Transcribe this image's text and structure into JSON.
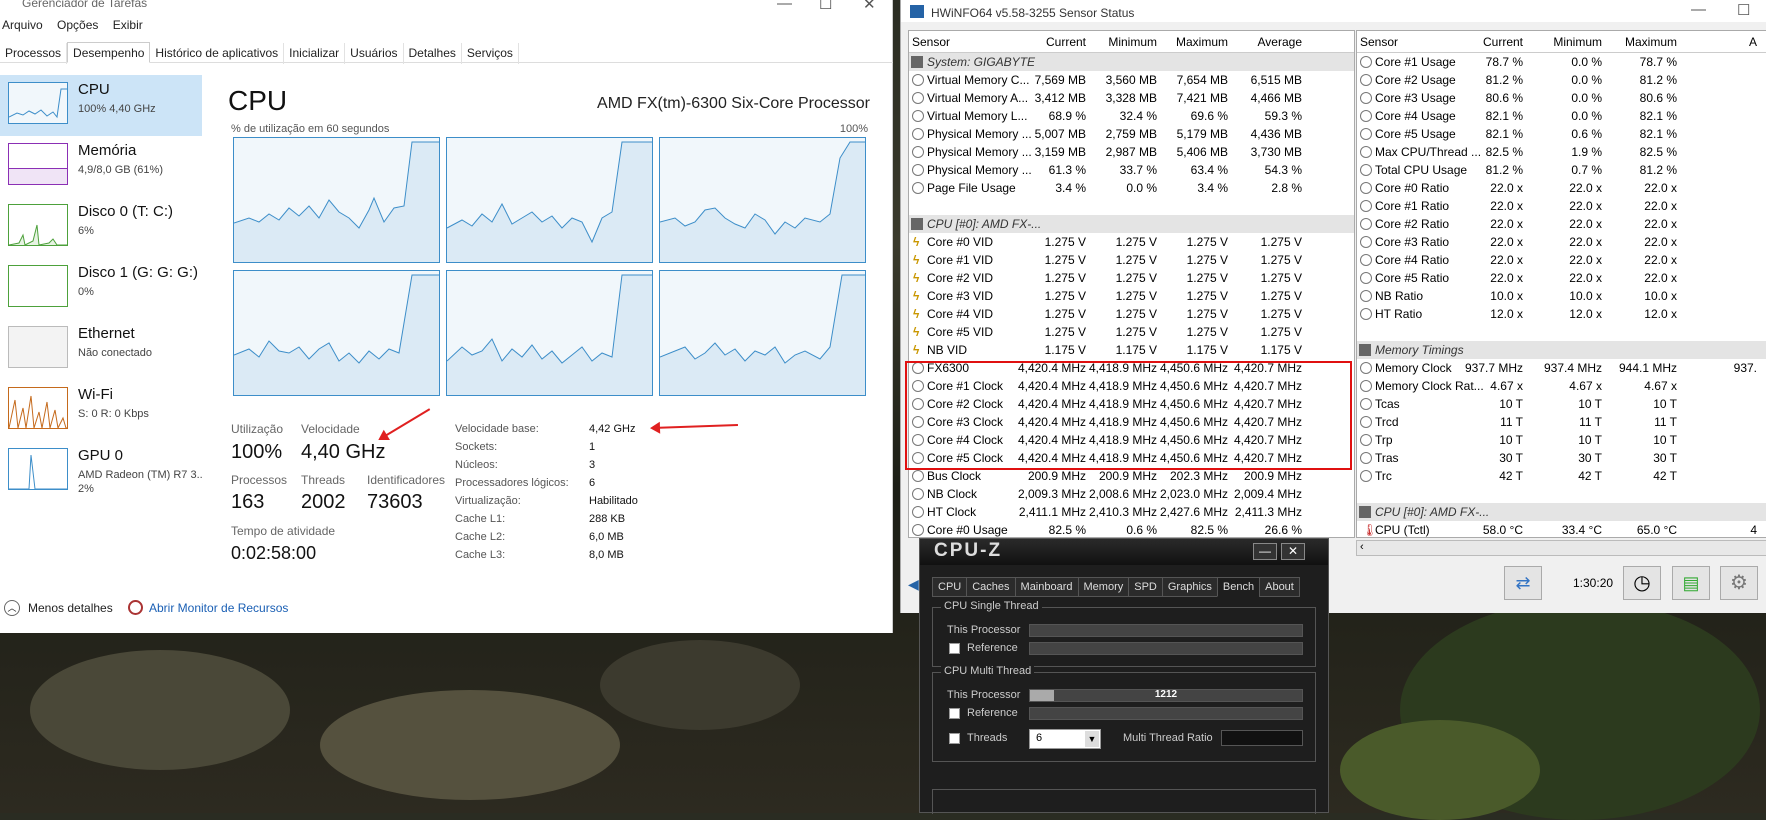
{
  "taskmgr": {
    "title": "Gerenciador de Tarefas",
    "menu": [
      "Arquivo",
      "Opções",
      "Exibir"
    ],
    "tabs": [
      "Processos",
      "Desempenho",
      "Histórico de aplicativos",
      "Inicializar",
      "Usuários",
      "Detalhes",
      "Serviços"
    ],
    "side": [
      {
        "name": "CPU",
        "sub": "100% 4,40 GHz"
      },
      {
        "name": "Memória",
        "sub": "4,9/8,0 GB (61%)"
      },
      {
        "name": "Disco 0 (T: C:)",
        "sub": "6%"
      },
      {
        "name": "Disco 1 (G: G: G:)",
        "sub": "0%"
      },
      {
        "name": "Ethernet",
        "sub": "Não conectado"
      },
      {
        "name": "Wi-Fi",
        "sub": "S: 0 R: 0 Kbps"
      },
      {
        "name": "GPU 0",
        "sub": "AMD Radeon (TM) R7 3...",
        "sub2": "2%"
      }
    ],
    "cpu_title": "CPU",
    "cpu_model": "AMD FX(tm)-6300 Six-Core Processor",
    "graph_label": "% de utilização em 60 segundos",
    "graph_max": "100%",
    "stats": {
      "util_lbl": "Utilização",
      "util": "100%",
      "speed_lbl": "Velocidade",
      "speed": "4,40 GHz",
      "proc_lbl": "Processos",
      "proc": "163",
      "thr_lbl": "Threads",
      "thr": "2002",
      "ids_lbl": "Identificadores",
      "ids": "73603",
      "uptime_lbl": "Tempo de atividade",
      "uptime": "0:02:58:00"
    },
    "info": [
      {
        "k": "Velocidade base:",
        "v": "4,42 GHz"
      },
      {
        "k": "Sockets:",
        "v": "1"
      },
      {
        "k": "Núcleos:",
        "v": "3"
      },
      {
        "k": "Processadores lógicos:",
        "v": "6"
      },
      {
        "k": "Virtualização:",
        "v": "Habilitado"
      },
      {
        "k": "Cache L1:",
        "v": "288 KB"
      },
      {
        "k": "Cache L2:",
        "v": "6,0 MB"
      },
      {
        "k": "Cache L3:",
        "v": "8,0 MB"
      }
    ],
    "footer": {
      "less": "Menos detalhes",
      "monitor": "Abrir Monitor de Recursos"
    }
  },
  "hwinfo": {
    "title": "HWiNFO64 v5.58-3255 Sensor Status",
    "headers": [
      "Sensor",
      "Current",
      "Minimum",
      "Maximum",
      "Average"
    ],
    "left_rows": [
      {
        "g": "System: GIGABYTE"
      },
      {
        "n": "Virtual Memory C...",
        "c": "7,569 MB",
        "mi": "3,560 MB",
        "ma": "7,654 MB",
        "av": "6,515 MB",
        "i": "o"
      },
      {
        "n": "Virtual Memory A...",
        "c": "3,412 MB",
        "mi": "3,328 MB",
        "ma": "7,421 MB",
        "av": "4,466 MB",
        "i": "o"
      },
      {
        "n": "Virtual Memory L...",
        "c": "68.9 %",
        "mi": "32.4 %",
        "ma": "69.6 %",
        "av": "59.3 %",
        "i": "o"
      },
      {
        "n": "Physical Memory ...",
        "c": "5,007 MB",
        "mi": "2,759 MB",
        "ma": "5,179 MB",
        "av": "4,436 MB",
        "i": "o"
      },
      {
        "n": "Physical Memory ...",
        "c": "3,159 MB",
        "mi": "2,987 MB",
        "ma": "5,406 MB",
        "av": "3,730 MB",
        "i": "o"
      },
      {
        "n": "Physical Memory ...",
        "c": "61.3 %",
        "mi": "33.7 %",
        "ma": "63.4 %",
        "av": "54.3 %",
        "i": "o"
      },
      {
        "n": "Page File Usage",
        "c": "3.4 %",
        "mi": "0.0 %",
        "ma": "3.4 %",
        "av": "2.8 %",
        "i": "o"
      },
      {
        "e": true
      },
      {
        "g": "CPU [#0]: AMD FX-..."
      },
      {
        "n": "Core #0 VID",
        "c": "1.275 V",
        "mi": "1.275 V",
        "ma": "1.275 V",
        "av": "1.275 V",
        "i": "b"
      },
      {
        "n": "Core #1 VID",
        "c": "1.275 V",
        "mi": "1.275 V",
        "ma": "1.275 V",
        "av": "1.275 V",
        "i": "b"
      },
      {
        "n": "Core #2 VID",
        "c": "1.275 V",
        "mi": "1.275 V",
        "ma": "1.275 V",
        "av": "1.275 V",
        "i": "b"
      },
      {
        "n": "Core #3 VID",
        "c": "1.275 V",
        "mi": "1.275 V",
        "ma": "1.275 V",
        "av": "1.275 V",
        "i": "b"
      },
      {
        "n": "Core #4 VID",
        "c": "1.275 V",
        "mi": "1.275 V",
        "ma": "1.275 V",
        "av": "1.275 V",
        "i": "b"
      },
      {
        "n": "Core #5 VID",
        "c": "1.275 V",
        "mi": "1.275 V",
        "ma": "1.275 V",
        "av": "1.275 V",
        "i": "b"
      },
      {
        "n": "NB VID",
        "c": "1.175 V",
        "mi": "1.175 V",
        "ma": "1.175 V",
        "av": "1.175 V",
        "i": "b"
      },
      {
        "n": "FX6300",
        "c": "4,420.4 MHz",
        "mi": "4,418.9 MHz",
        "ma": "4,450.6 MHz",
        "av": "4,420.7 MHz",
        "i": "o"
      },
      {
        "n": "Core #1 Clock",
        "c": "4,420.4 MHz",
        "mi": "4,418.9 MHz",
        "ma": "4,450.6 MHz",
        "av": "4,420.7 MHz",
        "i": "o"
      },
      {
        "n": "Core #2 Clock",
        "c": "4,420.4 MHz",
        "mi": "4,418.9 MHz",
        "ma": "4,450.6 MHz",
        "av": "4,420.7 MHz",
        "i": "o"
      },
      {
        "n": "Core #3 Clock",
        "c": "4,420.4 MHz",
        "mi": "4,418.9 MHz",
        "ma": "4,450.6 MHz",
        "av": "4,420.7 MHz",
        "i": "o"
      },
      {
        "n": "Core #4 Clock",
        "c": "4,420.4 MHz",
        "mi": "4,418.9 MHz",
        "ma": "4,450.6 MHz",
        "av": "4,420.7 MHz",
        "i": "o"
      },
      {
        "n": "Core #5 Clock",
        "c": "4,420.4 MHz",
        "mi": "4,418.9 MHz",
        "ma": "4,450.6 MHz",
        "av": "4,420.7 MHz",
        "i": "o"
      },
      {
        "n": "Bus Clock",
        "c": "200.9 MHz",
        "mi": "200.9 MHz",
        "ma": "202.3 MHz",
        "av": "200.9 MHz",
        "i": "o"
      },
      {
        "n": "NB Clock",
        "c": "2,009.3 MHz",
        "mi": "2,008.6 MHz",
        "ma": "2,023.0 MHz",
        "av": "2,009.4 MHz",
        "i": "o"
      },
      {
        "n": "HT Clock",
        "c": "2,411.1 MHz",
        "mi": "2,410.3 MHz",
        "ma": "2,427.6 MHz",
        "av": "2,411.3 MHz",
        "i": "o"
      },
      {
        "n": "Core #0 Usage",
        "c": "82.5 %",
        "mi": "0.6 %",
        "ma": "82.5 %",
        "av": "26.6 %",
        "i": "o"
      }
    ],
    "right_headers": [
      "Sensor",
      "Current",
      "Minimum",
      "Maximum",
      "A"
    ],
    "right_rows": [
      {
        "n": "Core #1 Usage",
        "c": "78.7 %",
        "mi": "0.0 %",
        "ma": "78.7 %",
        "i": "o"
      },
      {
        "n": "Core #2 Usage",
        "c": "81.2 %",
        "mi": "0.0 %",
        "ma": "81.2 %",
        "i": "o"
      },
      {
        "n": "Core #3 Usage",
        "c": "80.6 %",
        "mi": "0.0 %",
        "ma": "80.6 %",
        "i": "o"
      },
      {
        "n": "Core #4 Usage",
        "c": "82.1 %",
        "mi": "0.0 %",
        "ma": "82.1 %",
        "i": "o"
      },
      {
        "n": "Core #5 Usage",
        "c": "82.1 %",
        "mi": "0.6 %",
        "ma": "82.1 %",
        "i": "o"
      },
      {
        "n": "Max CPU/Thread ...",
        "c": "82.5 %",
        "mi": "1.9 %",
        "ma": "82.5 %",
        "i": "o"
      },
      {
        "n": "Total CPU Usage",
        "c": "81.2 %",
        "mi": "0.7 %",
        "ma": "81.2 %",
        "i": "o"
      },
      {
        "n": "Core #0 Ratio",
        "c": "22.0 x",
        "mi": "22.0 x",
        "ma": "22.0 x",
        "i": "o"
      },
      {
        "n": "Core #1 Ratio",
        "c": "22.0 x",
        "mi": "22.0 x",
        "ma": "22.0 x",
        "i": "o"
      },
      {
        "n": "Core #2 Ratio",
        "c": "22.0 x",
        "mi": "22.0 x",
        "ma": "22.0 x",
        "i": "o"
      },
      {
        "n": "Core #3 Ratio",
        "c": "22.0 x",
        "mi": "22.0 x",
        "ma": "22.0 x",
        "i": "o"
      },
      {
        "n": "Core #4 Ratio",
        "c": "22.0 x",
        "mi": "22.0 x",
        "ma": "22.0 x",
        "i": "o"
      },
      {
        "n": "Core #5 Ratio",
        "c": "22.0 x",
        "mi": "22.0 x",
        "ma": "22.0 x",
        "i": "o"
      },
      {
        "n": "NB Ratio",
        "c": "10.0 x",
        "mi": "10.0 x",
        "ma": "10.0 x",
        "i": "o"
      },
      {
        "n": "HT Ratio",
        "c": "12.0 x",
        "mi": "12.0 x",
        "ma": "12.0 x",
        "i": "o"
      },
      {
        "e": true
      },
      {
        "g": "Memory Timings"
      },
      {
        "n": "Memory Clock",
        "c": "937.7 MHz",
        "mi": "937.4 MHz",
        "ma": "944.1 MHz",
        "av": "937.",
        "i": "o"
      },
      {
        "n": "Memory Clock Rat...",
        "c": "4.67 x",
        "mi": "4.67 x",
        "ma": "4.67 x",
        "i": "o"
      },
      {
        "n": "Tcas",
        "c": "10 T",
        "mi": "10 T",
        "ma": "10 T",
        "i": "o"
      },
      {
        "n": "Trcd",
        "c": "11 T",
        "mi": "11 T",
        "ma": "11 T",
        "i": "o"
      },
      {
        "n": "Trp",
        "c": "10 T",
        "mi": "10 T",
        "ma": "10 T",
        "i": "o"
      },
      {
        "n": "Tras",
        "c": "30 T",
        "mi": "30 T",
        "ma": "30 T",
        "i": "o"
      },
      {
        "n": "Trc",
        "c": "42 T",
        "mi": "42 T",
        "ma": "42 T",
        "i": "o"
      },
      {
        "e": true
      },
      {
        "g": "CPU [#0]: AMD FX-..."
      },
      {
        "n": "CPU (Tctl)",
        "c": "58.0 °C",
        "mi": "33.4 °C",
        "ma": "65.0 °C",
        "av": "4",
        "i": "t"
      }
    ],
    "clock": "1:30:20"
  },
  "cpuz": {
    "title": "CPU-Z",
    "tabs": [
      "CPU",
      "Caches",
      "Mainboard",
      "Memory",
      "SPD",
      "Graphics",
      "Bench",
      "About"
    ],
    "single_legend": "CPU Single Thread",
    "multi_legend": "CPU Multi Thread",
    "this_proc": "This Processor",
    "reference": "Reference",
    "multi_score": "1212",
    "multi_fill": 0.09,
    "threads_lbl": "Threads",
    "threads_val": "6",
    "ratio_lbl": "Multi Thread Ratio"
  }
}
